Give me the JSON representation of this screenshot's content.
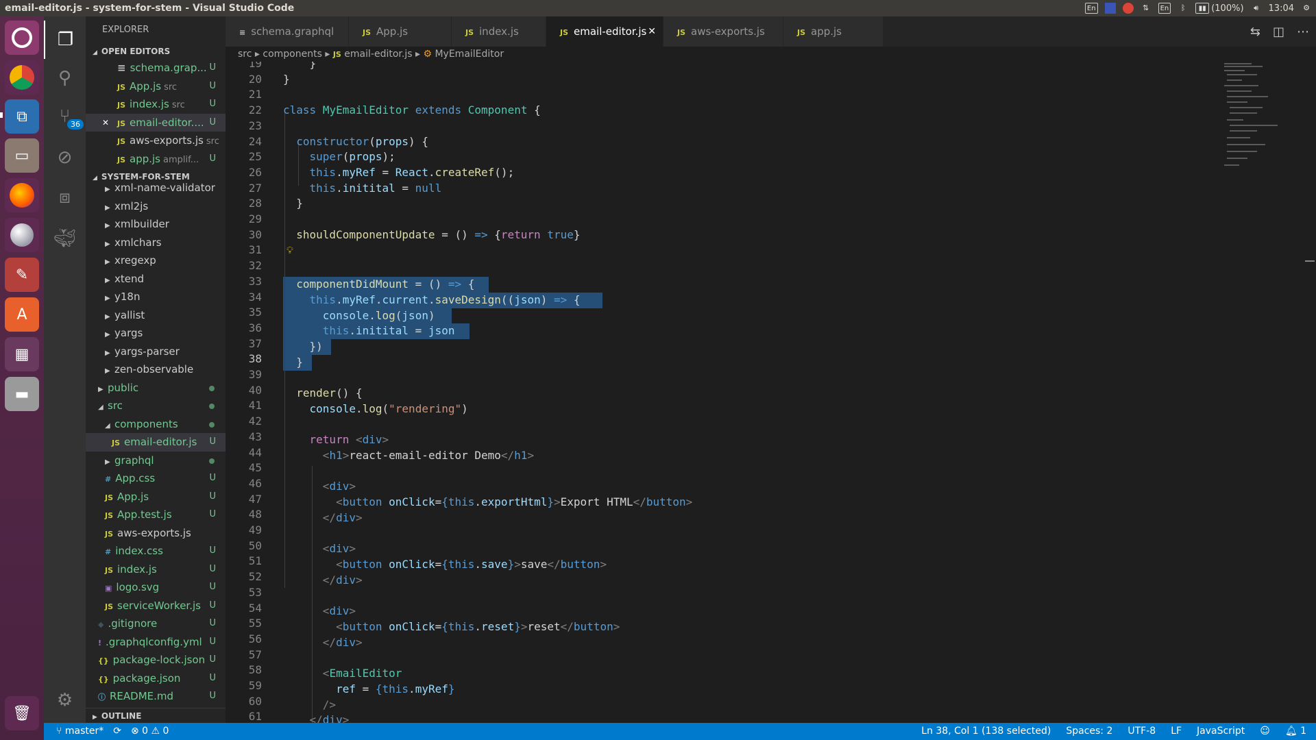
{
  "window": {
    "title": "email-editor.js - system-for-stem - Visual Studio Code"
  },
  "tray": {
    "lang1": "En",
    "lang2": "En",
    "battery": "(100%)",
    "time": "13:04"
  },
  "activity": {
    "scm_badge": "36"
  },
  "sidebar": {
    "header": "EXPLORER",
    "open_editors_title": "OPEN EDITORS",
    "open_editors": [
      {
        "icon": "≡",
        "name": "schema.grap...",
        "sub": "",
        "status": "U"
      },
      {
        "icon": "JS",
        "name": "App.js",
        "sub": "src",
        "status": "U"
      },
      {
        "icon": "JS",
        "name": "index.js",
        "sub": "src",
        "status": "U"
      },
      {
        "icon": "JS",
        "name": "email-editor....",
        "sub": "",
        "status": "U"
      },
      {
        "icon": "JS",
        "name": "aws-exports.js",
        "sub": "src",
        "status": ""
      },
      {
        "icon": "JS",
        "name": "app.js",
        "sub": "amplif...",
        "status": "U"
      }
    ],
    "project_title": "SYSTEM-FOR-STEM",
    "tree": [
      {
        "name": "xml-name-validator",
        "type": "folder",
        "depth": 2
      },
      {
        "name": "xml2js",
        "type": "folder",
        "depth": 2
      },
      {
        "name": "xmlbuilder",
        "type": "folder",
        "depth": 2
      },
      {
        "name": "xmlchars",
        "type": "folder",
        "depth": 2
      },
      {
        "name": "xregexp",
        "type": "folder",
        "depth": 2
      },
      {
        "name": "xtend",
        "type": "folder",
        "depth": 2
      },
      {
        "name": "y18n",
        "type": "folder",
        "depth": 2
      },
      {
        "name": "yallist",
        "type": "folder",
        "depth": 2
      },
      {
        "name": "yargs",
        "type": "folder",
        "depth": 2
      },
      {
        "name": "yargs-parser",
        "type": "folder",
        "depth": 2
      },
      {
        "name": "zen-observable",
        "type": "folder",
        "depth": 2
      },
      {
        "name": "public",
        "type": "folder",
        "depth": 1
      },
      {
        "name": "src",
        "type": "folder-open",
        "depth": 1
      },
      {
        "name": "components",
        "type": "folder-open",
        "depth": 2
      },
      {
        "name": "email-editor.js",
        "type": "js",
        "depth": 3,
        "status": "U"
      },
      {
        "name": "graphql",
        "type": "folder",
        "depth": 2
      },
      {
        "name": "App.css",
        "type": "css",
        "depth": 2,
        "status": "U"
      },
      {
        "name": "App.js",
        "type": "js",
        "depth": 2,
        "status": "U"
      },
      {
        "name": "App.test.js",
        "type": "js",
        "depth": 2,
        "status": "U"
      },
      {
        "name": "aws-exports.js",
        "type": "js",
        "depth": 2,
        "status": ""
      },
      {
        "name": "index.css",
        "type": "css",
        "depth": 2,
        "status": "U"
      },
      {
        "name": "index.js",
        "type": "js",
        "depth": 2,
        "status": "U"
      },
      {
        "name": "logo.svg",
        "type": "svg",
        "depth": 2,
        "status": "U"
      },
      {
        "name": "serviceWorker.js",
        "type": "js",
        "depth": 2,
        "status": "U"
      },
      {
        "name": ".gitignore",
        "type": "git",
        "depth": 1,
        "status": "U"
      },
      {
        "name": ".graphqlconfig.yml",
        "type": "yml",
        "depth": 1,
        "status": "U"
      },
      {
        "name": "package-lock.json",
        "type": "json",
        "depth": 1,
        "status": "U"
      },
      {
        "name": "package.json",
        "type": "json",
        "depth": 1,
        "status": "U"
      },
      {
        "name": "README.md",
        "type": "info",
        "depth": 1,
        "status": "U"
      }
    ],
    "outline_title": "OUTLINE"
  },
  "tabs": [
    {
      "icon": "≡",
      "label": "schema.graphql"
    },
    {
      "icon": "JS",
      "label": "App.js"
    },
    {
      "icon": "JS",
      "label": "index.js"
    },
    {
      "icon": "JS",
      "label": "email-editor.js",
      "active": true
    },
    {
      "icon": "JS",
      "label": "aws-exports.js"
    },
    {
      "icon": "JS",
      "label": "app.js"
    }
  ],
  "breadcrumb": {
    "p1": "src",
    "p2": "components",
    "p3": "email-editor.js",
    "p4": "MyEmailEditor"
  },
  "code": {
    "line_numbers": [
      "19",
      "20",
      "21",
      "22",
      "23",
      "24",
      "25",
      "26",
      "27",
      "28",
      "29",
      "30",
      "31",
      "32",
      "33",
      "34",
      "35",
      "36",
      "37",
      "38",
      "39",
      "40",
      "41",
      "42",
      "43",
      "44",
      "45",
      "46",
      "47",
      "48",
      "49",
      "50",
      "51",
      "52",
      "53",
      "54",
      "55",
      "56",
      "57",
      "58",
      "59",
      "60",
      "61"
    ],
    "current_line": "38"
  },
  "status": {
    "branch": "master*",
    "errors": "0",
    "warnings": "0",
    "cursor": "Ln 38, Col 1 (138 selected)",
    "spaces": "Spaces: 2",
    "encoding": "UTF-8",
    "eol": "LF",
    "language": "JavaScript",
    "notifications": "1"
  },
  "colors": {
    "accent": "#007acc",
    "selection": "#264f78",
    "untracked": "#73c991"
  }
}
